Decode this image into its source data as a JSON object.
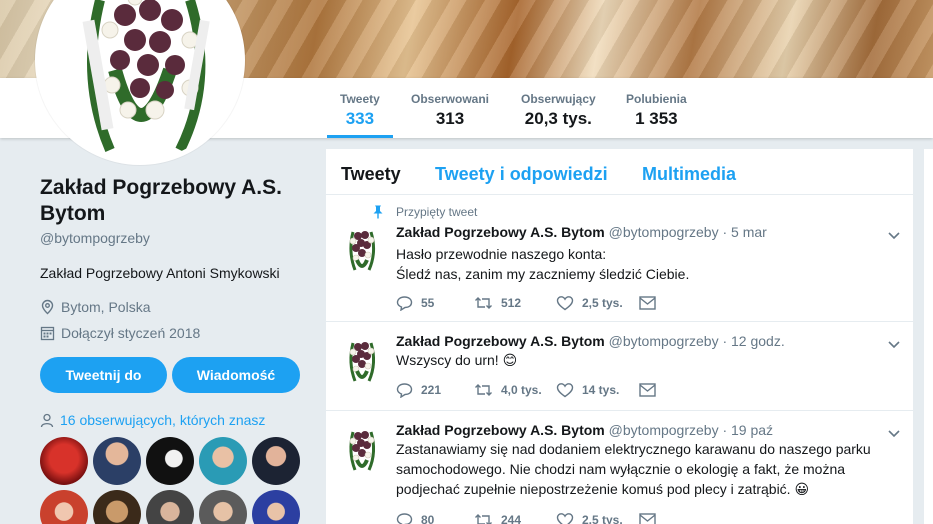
{
  "profile": {
    "name": "Zakład Pogrzebowy A.S. Bytom",
    "handle": "@bytompogrzeby",
    "bio": "Zakład Pogrzebowy Antoni Smykowski",
    "location": "Bytom, Polska",
    "joined": "Dołączył styczeń 2018",
    "tweet_button": "Tweetnij do",
    "message_button": "Wiadomość",
    "followers_you_know": "16 obserwujących, których znasz"
  },
  "stats": [
    {
      "label": "Tweety",
      "value": "333"
    },
    {
      "label": "Obserwowani",
      "value": "313"
    },
    {
      "label": "Obserwujący",
      "value": "20,3 tys."
    },
    {
      "label": "Polubienia",
      "value": "1 353"
    }
  ],
  "tabs": [
    "Tweety",
    "Tweety i odpowiedzi",
    "Multimedia"
  ],
  "tweets": [
    {
      "pinned_label": "Przypięty tweet",
      "name": "Zakład Pogrzebowy A.S. Bytom",
      "handle": "@bytompogrzeby",
      "time": "· 5 mar",
      "line1": "Hasło przewodnie naszego konta:",
      "line2": "Śledź nas, zanim my zaczniemy śledzić Ciebie.",
      "replies": "55",
      "retweets": "512",
      "likes": "2,5 tys."
    },
    {
      "name": "Zakład Pogrzebowy A.S. Bytom",
      "handle": "@bytompogrzeby",
      "time": "· 12 godz.",
      "line1": "Wszyscy do urn! 😊",
      "replies": "221",
      "retweets": "4,0 tys.",
      "likes": "14 tys."
    },
    {
      "name": "Zakład Pogrzebowy A.S. Bytom",
      "handle": "@bytompogrzeby",
      "time": "· 19 paź",
      "line1": "Zastanawiamy się nad dodaniem elektrycznego karawanu do naszego parku",
      "line2": "samochodowego. Nie chodzi nam wyłącznie o ekologię a fakt, że można",
      "line3": "podjechać zupełnie niepostrzeżenie komuś pod plecy i zatrąbić. 😀",
      "replies": "80",
      "retweets": "244",
      "likes": "2,5 tys."
    }
  ],
  "colors": {
    "accent": "#1da1f2",
    "text": "#14171a",
    "muted": "#657786",
    "background": "#e6ecf0"
  }
}
